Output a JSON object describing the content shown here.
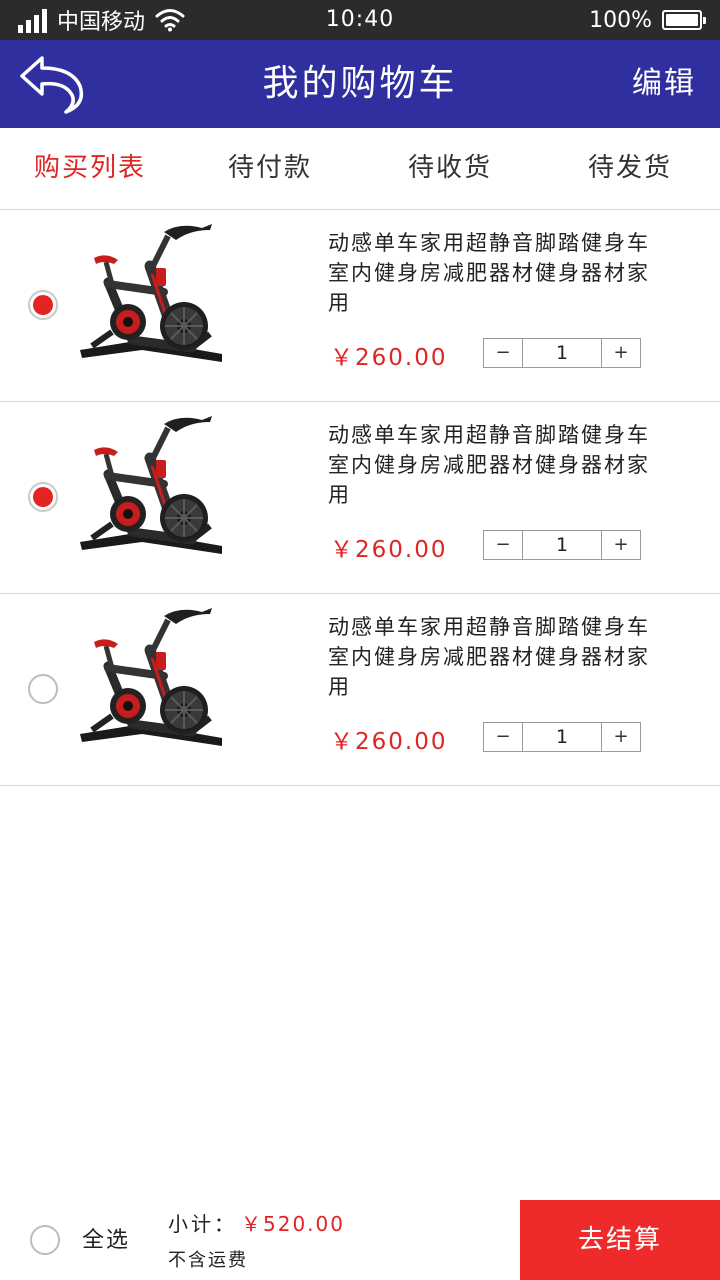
{
  "status_bar": {
    "carrier": "中国移动",
    "time": "10:40",
    "battery": "100%",
    "icons": [
      "signal-icon",
      "wifi-icon",
      "battery-icon"
    ]
  },
  "nav": {
    "back_icon": "back-arrow-icon",
    "title": "我的购物车",
    "edit_label": "编辑"
  },
  "tabs": [
    {
      "label": "购买列表",
      "active": true
    },
    {
      "label": "待付款",
      "active": false
    },
    {
      "label": "待收货",
      "active": false
    },
    {
      "label": "待发货",
      "active": false
    }
  ],
  "items": [
    {
      "title": "动感单车家用超静音脚踏健身车室内健身房减肥器材健身器材家用",
      "price": "￥260.00",
      "quantity": "1",
      "minus": "−",
      "plus": "+",
      "selected": true
    },
    {
      "title": "动感单车家用超静音脚踏健身车室内健身房减肥器材健身器材家用",
      "price": "￥260.00",
      "quantity": "1",
      "minus": "−",
      "plus": "+",
      "selected": true
    },
    {
      "title": "动感单车家用超静音脚踏健身车室内健身房减肥器材健身器材家用",
      "price": "￥260.00",
      "quantity": "1",
      "minus": "−",
      "plus": "+",
      "selected": false
    }
  ],
  "footer": {
    "select_all_label": "全选",
    "select_all_checked": false,
    "subtotal_label": "小计：",
    "subtotal_value": "￥520.00",
    "shipping_note": "不含运费",
    "checkout_label": "去结算"
  },
  "colors": {
    "nav_background": "#2f2fa0",
    "accent_red": "#e02424",
    "checkout_button": "#ee2a2a",
    "status_bar": "#2b2b2b"
  }
}
